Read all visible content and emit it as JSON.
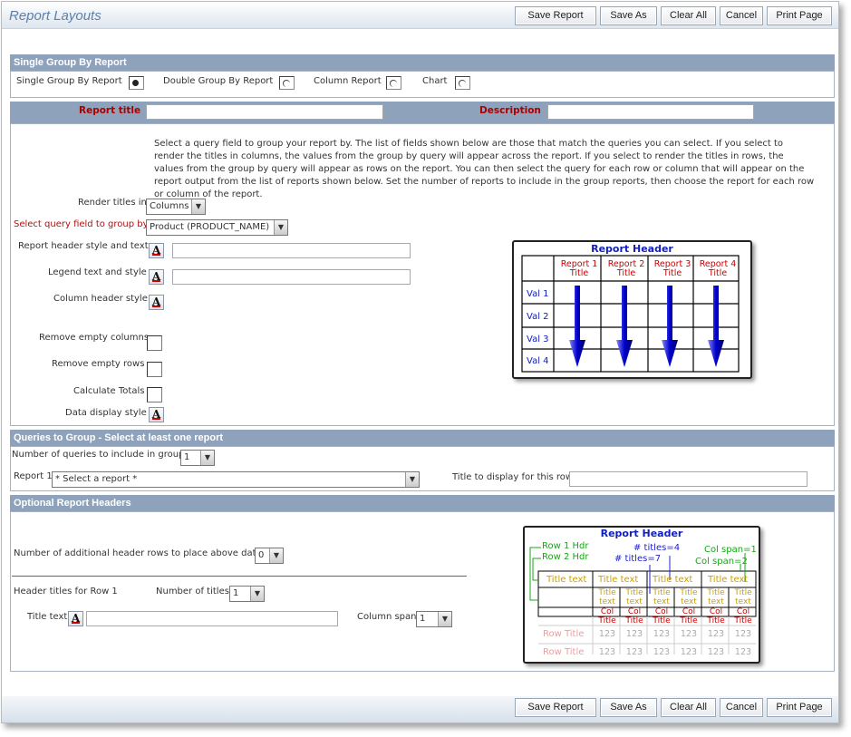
{
  "header": {
    "title": "Report Layouts"
  },
  "toolbar": {
    "save_report": "Save Report",
    "save_as": "Save As",
    "clear_all": "Clear All",
    "cancel": "Cancel",
    "print_page": "Print Page"
  },
  "single_group": {
    "section_title": "Single Group By Report",
    "options": [
      "Single Group By Report",
      "Double Group By Report",
      "Column Report",
      "Chart"
    ],
    "selected": "Single Group By Report"
  },
  "report_info": {
    "report_title_label": "Report title",
    "description_label": "Description"
  },
  "instructions": "Select a query field to group your report by. The list of fields shown below are those that match the queries you can select. If you select to render the titles in columns, the values from the group by query will appear across the report. If you select to render the titles in rows, the values from the group by query will appear as rows on the report. You can then select the query for each row or column that will appear on the report output from the list of reports shown below. Set the number of reports to include in the group reports, then choose the report for each row or column of the report.",
  "form": {
    "render_titles_label": "Render titles in",
    "render_titles_value": "Columns",
    "group_field_label": "Select query field to group by",
    "group_field_value": "Product (PRODUCT_NAME)",
    "report_header_label": "Report header style and text",
    "legend_label": "Legend text and style",
    "column_header_label": "Column header style",
    "remove_empty_columns": "Remove empty columns",
    "remove_empty_rows": "Remove empty rows",
    "calculate_totals": "Calculate Totals",
    "data_display_style": "Data display style"
  },
  "diagram1": {
    "header": "Report Header",
    "columns": [
      "Report 1",
      "Report 2",
      "Report 3",
      "Report 4"
    ],
    "col_sub": "Title",
    "rows": [
      "Val 1",
      "Val 2",
      "Val 3",
      "Val 4"
    ]
  },
  "queries": {
    "section_title": "Queries to Group - Select at least one report",
    "count_label": "Number of queries to include in group",
    "count_value": "1",
    "report_label": "Report 1",
    "report_value": "* Select a report *",
    "row_title_label": "Title to display for this row"
  },
  "optional": {
    "section_title": "Optional Report Headers",
    "extra_rows_label": "Number of additional header rows to place above data",
    "extra_rows_value": "0",
    "row1_label": "Header titles for Row 1",
    "num_titles_label": "Number of titles",
    "num_titles_value": "1",
    "title_text_label": "Title text",
    "col_span_label": "Column span",
    "col_span_value": "1"
  },
  "diagram2": {
    "header": "Report Header",
    "row1_hdr": "Row 1 Hdr",
    "row2_hdr": "Row 2 Hdr",
    "titles4": "# titles=4",
    "titles7": "# titles=7",
    "colspan1": "Col span=1",
    "colspan2": "Col span=2",
    "title_text": "Title text",
    "small_title": "Title",
    "small_text": "text",
    "col": "Col",
    "col_title": "Title",
    "row_title": "Row Title",
    "num": "123"
  }
}
